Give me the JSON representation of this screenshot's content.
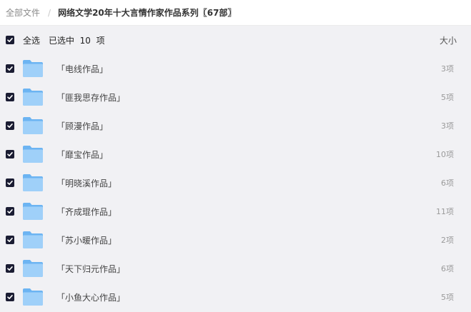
{
  "breadcrumb": {
    "root": "全部文件",
    "separator": "/",
    "current": "网络文学20年十大言情作家作品系列〖67部〗"
  },
  "list_header": {
    "select_all": "全选",
    "selected": "已选中",
    "count": "10",
    "unit": "项",
    "size_column": "大小"
  },
  "items": [
    {
      "name": "「电线作品」",
      "size": "3项",
      "checked": true
    },
    {
      "name": "「匪我思存作品」",
      "size": "5项",
      "checked": true
    },
    {
      "name": "「顾漫作品」",
      "size": "3项",
      "checked": true
    },
    {
      "name": "「靡宝作品」",
      "size": "10项",
      "checked": true
    },
    {
      "name": "「明晓溪作品」",
      "size": "6项",
      "checked": true
    },
    {
      "name": "「齐成琨作品」",
      "size": "11项",
      "checked": true
    },
    {
      "name": "「苏小暖作品」",
      "size": "2项",
      "checked": true
    },
    {
      "name": "「天下归元作品」",
      "size": "6项",
      "checked": true
    },
    {
      "name": "「小鱼大心作品」",
      "size": "5项",
      "checked": true
    }
  ],
  "icons": {
    "checkbox": "checkbox-checked-icon",
    "folder": "folder-icon"
  },
  "colors": {
    "checkbox": "#1b1d33",
    "folder_light": "#9fd0f9",
    "folder_dark": "#6cb4f2",
    "list_background": "#f1f1f4"
  }
}
